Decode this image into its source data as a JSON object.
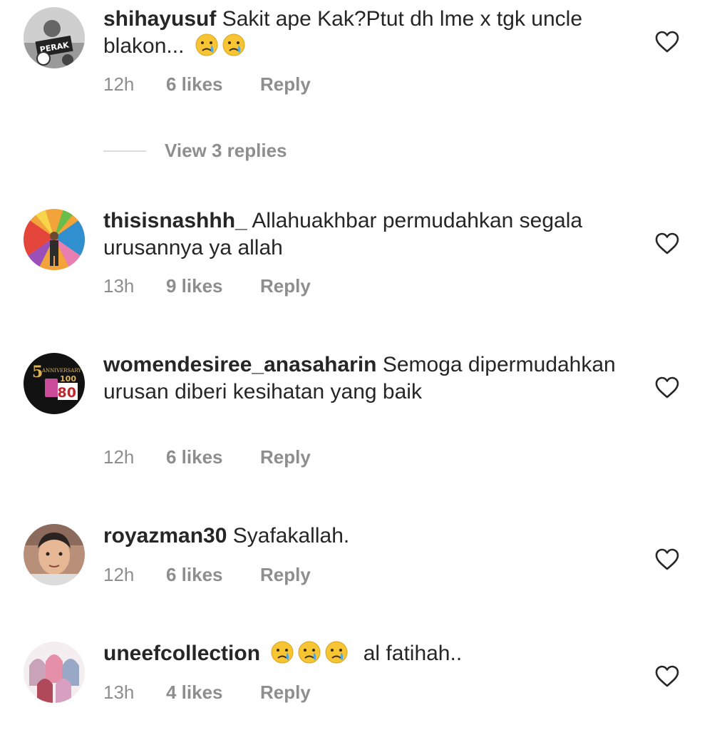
{
  "comments": [
    {
      "username": "shihayusuf",
      "text_before": "Sakit ape Kak?Ptut dh lme x tgk uncle blakon...",
      "emoji_count": 2,
      "text_after": "",
      "time": "12h",
      "likes": "6 likes",
      "reply": "Reply",
      "avatar_label": "PERAK"
    },
    {
      "username": "thisisnashhh_",
      "text_before": "Allahuakhbar permudahkan segala urusannya ya allah",
      "emoji_count": 0,
      "text_after": "",
      "time": "13h",
      "likes": "9 likes",
      "reply": "Reply"
    },
    {
      "username": "womendesiree_anasaharin",
      "text_before": "Semoga dipermudahkan urusan diberi kesihatan yang baik",
      "emoji_count": 0,
      "text_after": "",
      "time": "12h",
      "likes": "6 likes",
      "reply": "Reply",
      "avatar_label_top": "5",
      "avatar_label_mid": "ANNIVERSARY",
      "avatar_label_num1": "100",
      "avatar_label_num2": "80"
    },
    {
      "username": "royazman30",
      "text_before": "Syafakallah.",
      "emoji_count": 0,
      "text_after": "",
      "time": "12h",
      "likes": "6 likes",
      "reply": "Reply"
    },
    {
      "username": "uneefcollection",
      "text_before": "",
      "emoji_count": 3,
      "text_after": "al fatihah..",
      "time": "13h",
      "likes": "4 likes",
      "reply": "Reply"
    }
  ],
  "view_replies": "View 3 replies",
  "colors": {
    "text": "#262626",
    "muted": "#8e8e8e",
    "divider": "#dbdbdb"
  }
}
